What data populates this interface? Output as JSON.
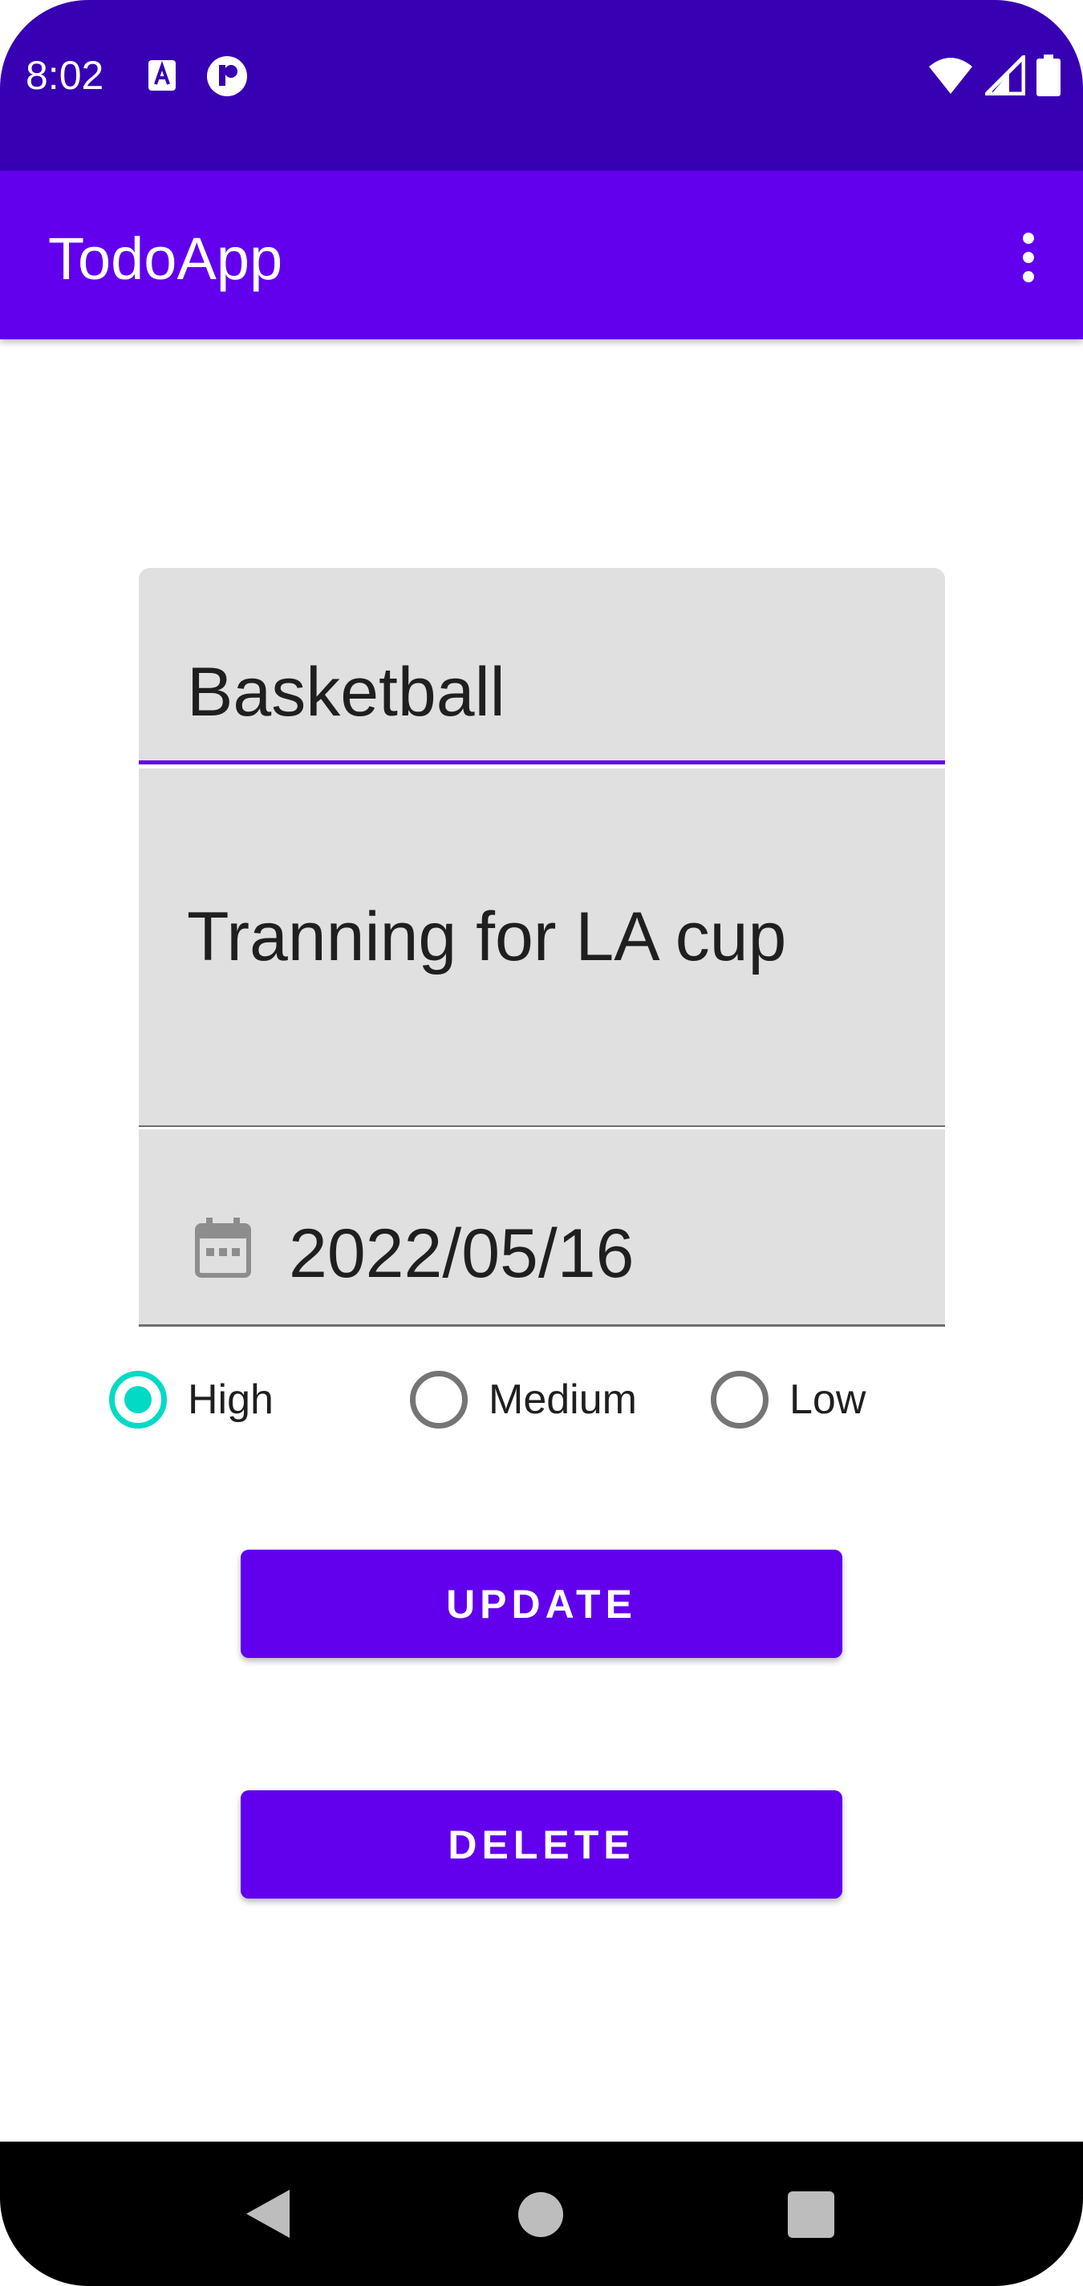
{
  "status_bar": {
    "time": "8:02",
    "left_icons": [
      "accessibility-a-icon",
      "app-notification-icon"
    ],
    "right_icons": [
      "wifi-icon",
      "cell-signal-icon",
      "battery-icon"
    ],
    "background_color": "#3700b3"
  },
  "app_bar": {
    "title": "TodoApp",
    "menu_icon": "overflow-menu-icon",
    "background_color": "#6200ee"
  },
  "form": {
    "title_value": "Basketball",
    "description_value": "Tranning for LA cup",
    "date_value": "2022/05/16",
    "date_icon": "calendar-icon",
    "priority": {
      "options": [
        "High",
        "Medium",
        "Low"
      ],
      "selected": "High",
      "accent_color": "#03dac5"
    }
  },
  "buttons": {
    "update_label": "UPDATE",
    "delete_label": "DELETE",
    "color": "#6200ee"
  },
  "nav_bar": {
    "icons": [
      "back-icon",
      "home-icon",
      "recents-icon"
    ]
  }
}
